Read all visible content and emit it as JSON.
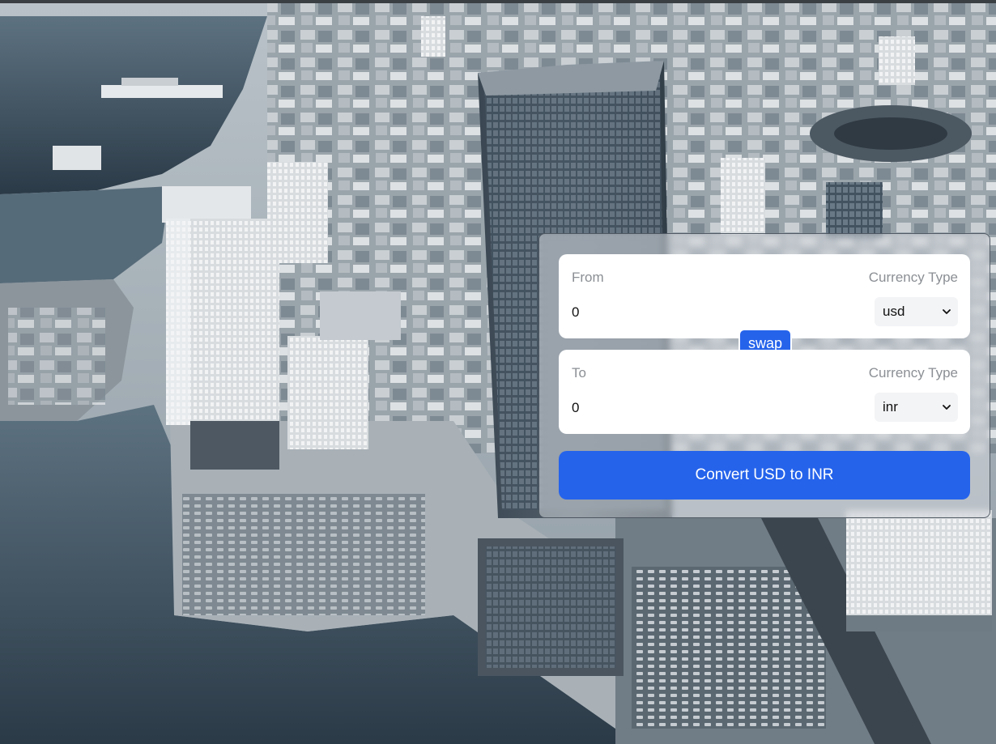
{
  "colors": {
    "accent": "#2563eb",
    "field_background": "#ffffff",
    "muted_text": "#8b8f94",
    "select_background": "#f3f4f6"
  },
  "background": {
    "icon": "city-aerial-photo"
  },
  "converter": {
    "from": {
      "label": "From",
      "currency_type_label": "Currency Type",
      "amount_value": "0",
      "currency_selected": "usd"
    },
    "swap_label": "swap",
    "to": {
      "label": "To",
      "currency_type_label": "Currency Type",
      "amount_value": "0",
      "currency_selected": "inr"
    },
    "convert_label": "Convert USD to INR"
  }
}
